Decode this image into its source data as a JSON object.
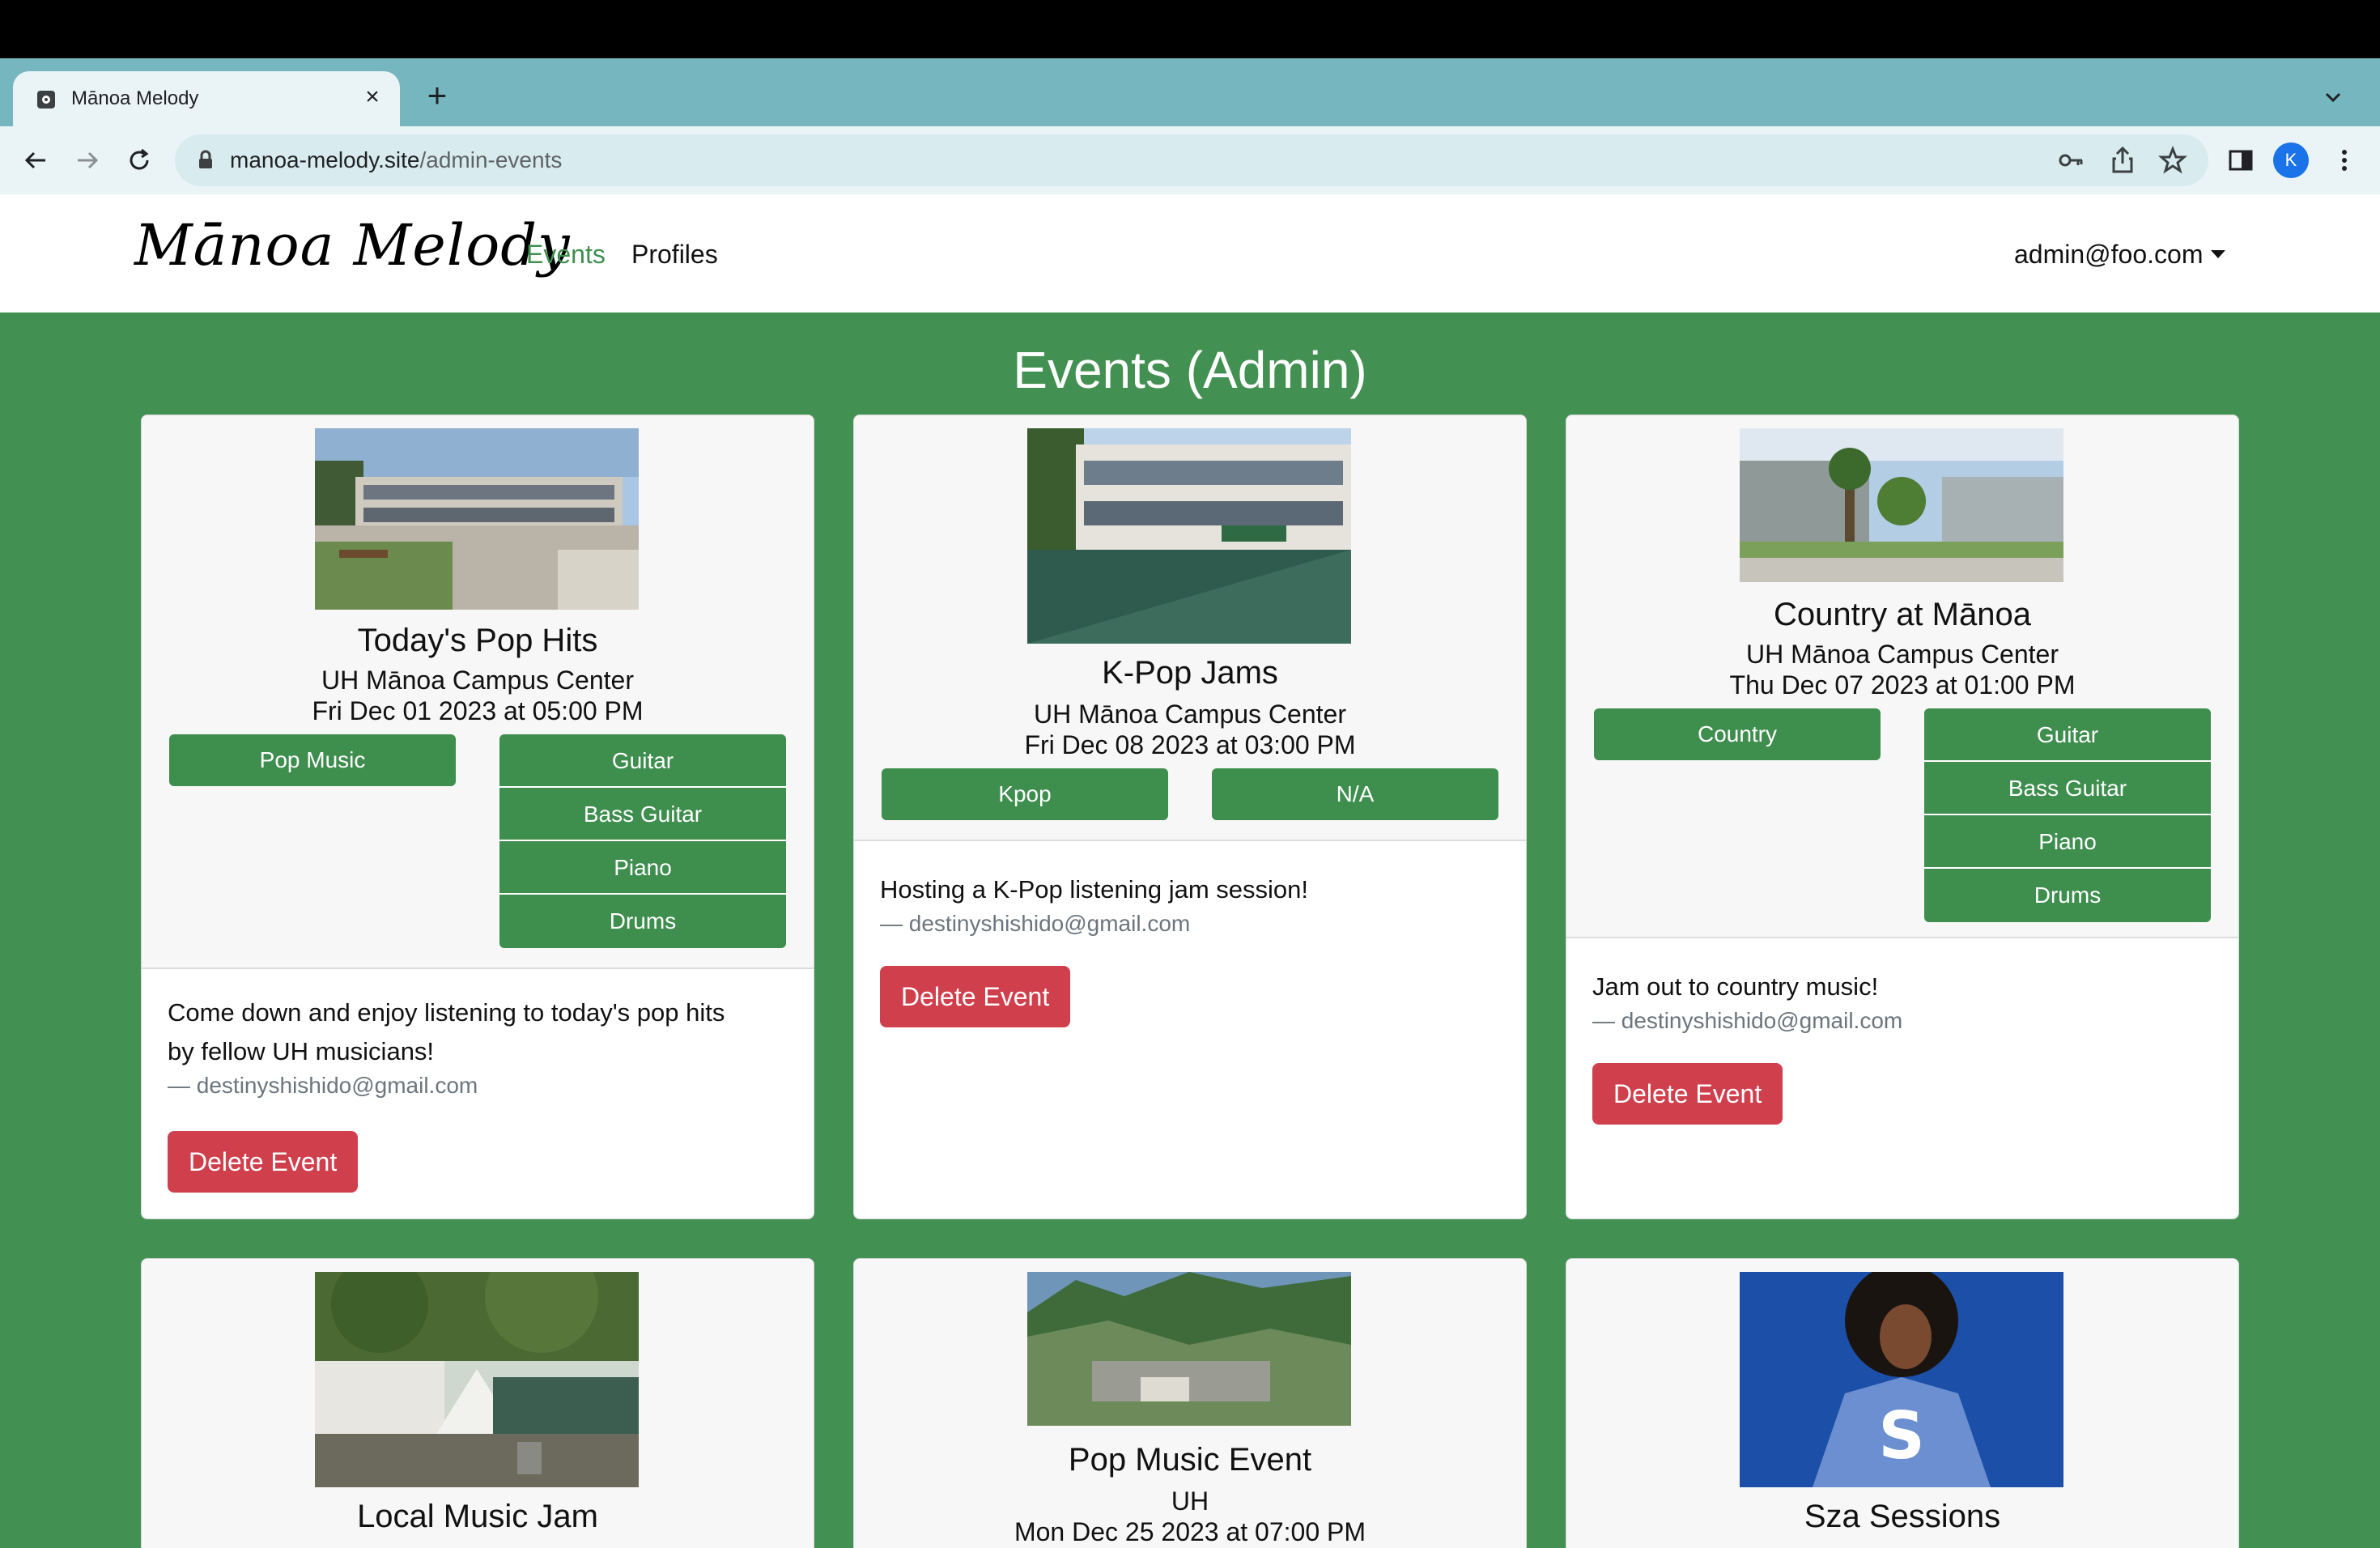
{
  "browser": {
    "tab_title": "Mānoa Melody",
    "url_domain": "manoa-melody.site",
    "url_path": "/admin-events",
    "profile_initial": "K"
  },
  "navbar": {
    "brand": "Mānoa Melody",
    "events_link": "Events",
    "profiles_link": "Profiles",
    "user_menu": "admin@foo.com"
  },
  "page": {
    "title": "Events (Admin)"
  },
  "events": [
    {
      "title": "Today's Pop Hits",
      "location": "UH Mānoa Campus Center",
      "datetime": "Fri Dec 01 2023 at 05:00 PM",
      "genre": "Pop Music",
      "instruments": [
        "Guitar",
        "Bass Guitar",
        "Piano",
        "Drums"
      ],
      "description_line1": "Come down and enjoy listening to today's pop hits",
      "description_line2": "by fellow UH musicians!",
      "author": "— destinyshishido@gmail.com",
      "delete_label": "Delete Event"
    },
    {
      "title": "K-Pop Jams",
      "location": "UH Mānoa Campus Center",
      "datetime": "Fri Dec 08 2023 at 03:00 PM",
      "genre": "Kpop",
      "instruments": [
        "N/A"
      ],
      "description_line1": "Hosting a K-Pop listening jam session!",
      "author": "— destinyshishido@gmail.com",
      "delete_label": "Delete Event"
    },
    {
      "title": "Country at Mānoa",
      "location": "UH Mānoa Campus Center",
      "datetime": "Thu Dec 07 2023 at 01:00 PM",
      "genre": "Country",
      "instruments": [
        "Guitar",
        "Bass Guitar",
        "Piano",
        "Drums"
      ],
      "description_line1": "Jam out to country music!",
      "author": "— destinyshishido@gmail.com",
      "delete_label": "Delete Event"
    },
    {
      "title": "Local Music Jam"
    },
    {
      "title": "Pop Music Event",
      "location": "UH",
      "datetime": "Mon Dec 25 2023 at 07:00 PM"
    },
    {
      "title": "Sza Sessions"
    }
  ]
}
